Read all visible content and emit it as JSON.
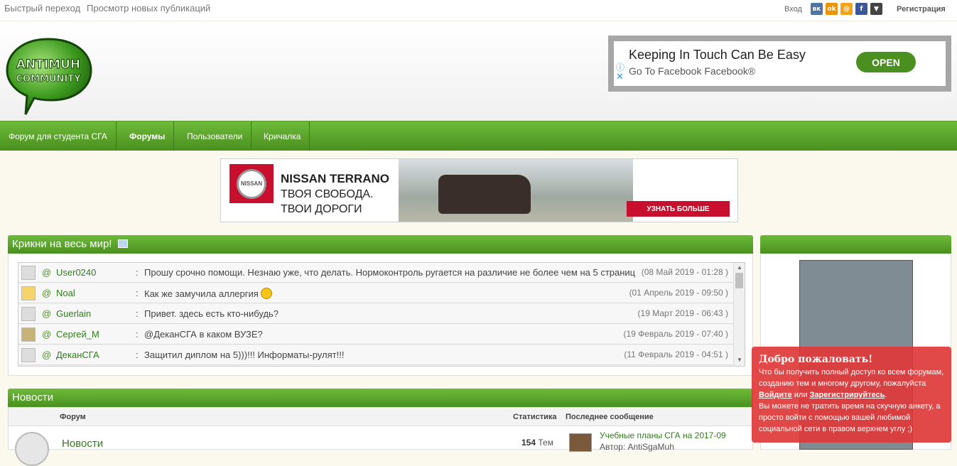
{
  "topbar": {
    "quick_nav": "Быстрый переход",
    "new_pubs": "Просмотр новых публикаций",
    "login": "Вход",
    "social": [
      {
        "icon": "vk-icon",
        "glyph": "вк",
        "color": "#4c75a3"
      },
      {
        "icon": "odnoklassniki-icon",
        "glyph": "ok",
        "color": "#f39200"
      },
      {
        "icon": "mailru-icon",
        "glyph": "@",
        "color": "#f4a31a"
      },
      {
        "icon": "facebook-icon",
        "glyph": "f",
        "color": "#3b5998"
      },
      {
        "icon": "more-icon",
        "glyph": "▼",
        "color": "#444444"
      }
    ],
    "register": "Регистрация"
  },
  "header": {
    "logo_text_1": "ANTIMUH",
    "logo_text_2": "COMMUNITY",
    "ad": {
      "title": "Keeping In Touch Can Be Easy",
      "subtitle": "Go To Facebook Facebook®",
      "info": "ⓘ",
      "close": "✕",
      "button": "OPEN"
    }
  },
  "nav": {
    "items": [
      {
        "label": "Форум для студента СГА",
        "active": false
      },
      {
        "label": "Форумы",
        "active": true
      },
      {
        "label": "Пользователи",
        "active": false
      },
      {
        "label": "Кричалка",
        "active": false
      }
    ]
  },
  "banner": {
    "brand": "NISSAN",
    "line1": "NISSAN TERRANO",
    "line2": "ТВОЯ СВОБОДА.",
    "line3": "ТВОИ ДОРОГИ",
    "button": "УЗНАТЬ БОЛЬШЕ"
  },
  "shoutbox": {
    "title": "Крикни на весь мир!",
    "rows": [
      {
        "user": "User0240",
        "message": "Прошу срочно помощи. Незнаю уже, что делать. Нормоконтроль ругается на различие не более чем на 5 страниц",
        "date": "(08 Май 2019 - 01:28 )"
      },
      {
        "user": "Noal",
        "message": "Как же замучила аллергия",
        "date": "(01 Апрель 2019 - 09:50 )",
        "smiley": true
      },
      {
        "user": "Guerlain",
        "message": "Привет. здесь есть кто-нибудь?",
        "date": "(19 Март 2019 - 06:43 )"
      },
      {
        "user": "Сергей_М",
        "message": "@ДеканСГА в каком ВУЗЕ?",
        "date": "(19 Февраль 2019 - 07:40 )"
      },
      {
        "user": "ДеканСГА",
        "message": "Защитил диплом на 5)))!!! Информаты-рулят!!!",
        "date": "(11 Февраль 2019 - 04:51 )"
      }
    ]
  },
  "news": {
    "title": "Новости",
    "col_forum": "Форум",
    "col_stats": "Статистика",
    "col_last": "Последнее сообщение",
    "row": {
      "name": "Новости",
      "topics_count": "154",
      "topics_label": "Тем",
      "last_title": "Учебные планы СГА на 2017-09",
      "last_author": "Автор: AntiSgaMuh"
    }
  },
  "welcome": {
    "title": "Добро пожаловать!",
    "text1": "Что бы получить полный доступ ко всем форумам, созданию тем и многому другому, пожалуйста",
    "login_link": "Войдите",
    "or": "или",
    "register_link": "Зарегистрируйтесь",
    "text2": "Вы можете не тратить время на скучную анкету, а просто войти с помощью вашей любимой социальной сети в правом верхнем углу ;)"
  }
}
